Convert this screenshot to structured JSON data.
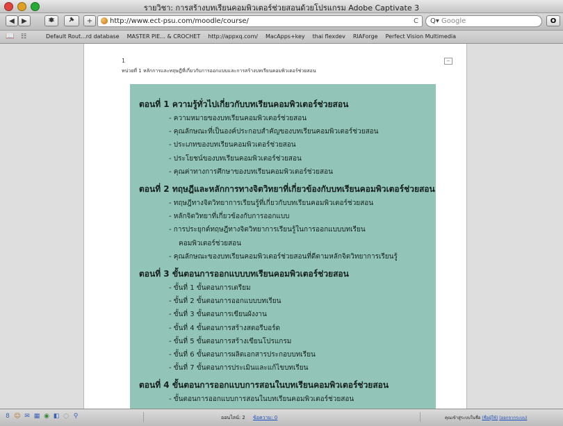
{
  "window": {
    "title": "รายวิชา: การสร้างบทเรียนคอมพิวเตอร์ช่วยสอนด้วยโปรแกรม Adobe Captivate 3"
  },
  "toolbar": {
    "back": "◀",
    "forward": "▶",
    "add": "+",
    "url": "http://www.ect-psu.com/moodle/course/",
    "reload": "C",
    "search_placeholder": "Google",
    "o_button": "O"
  },
  "bookmarks": [
    "Default Rout...rd database",
    "MASTER PIE... & CROCHET",
    "http://appxq.com/",
    "MacApps+key",
    "thai flexdev",
    "RIAForge",
    "Perfect Vision Multimedia"
  ],
  "course": {
    "section_number": "1",
    "section_heading": "หน่วยที่ 1 หลักการและทฤษฎีที่เกี่ยวกับการออกแบบและการสร้างบทเรียนคอมพิวเตอร์ช่วยสอน",
    "collapse_icon": "−"
  },
  "slide": [
    {
      "type": "title",
      "text": "ตอนที่ 1 ความรู้ทั่วไปเกี่ยวกับบทเรียนคอมพิวเตอร์ช่วยสอน"
    },
    {
      "type": "item",
      "text": "- ความหมายของบทเรียนคอมพิวเตอร์ช่วยสอน"
    },
    {
      "type": "item",
      "text": "- คุณลักษณะที่เป็นองค์ประกอบสำคัญของบทเรียนคอมพิวเตอร์ช่วยสอน"
    },
    {
      "type": "item",
      "text": "- ประเภทของบทเรียนคอมพิวเตอร์ช่วยสอน"
    },
    {
      "type": "item",
      "text": "- ประโยชน์ของบทเรียนคอมพิวเตอร์ช่วยสอน"
    },
    {
      "type": "item",
      "text": "- คุณค่าทางการศึกษาของบทเรียนคอมพิวเตอร์ช่วยสอน"
    },
    {
      "type": "title",
      "text": "ตอนที่ 2 ทฤษฎีและหลักการทางจิตวิทยาที่เกี่ยวข้องกับบทเรียนคอมพิวเตอร์ช่วยสอน"
    },
    {
      "type": "item",
      "text": "- ทฤษฎีทางจิตวิทยาการเรียนรู้ที่เกี่ยวกับบทเรียนคอมพิวเตอร์ช่วยสอน"
    },
    {
      "type": "item",
      "text": "- หลักจิตวิทยาที่เกี่ยวข้องกับการออกแบบ"
    },
    {
      "type": "item",
      "text": "- การประยุกต์ทฤษฎีทางจิตวิทยาการเรียนรู้ในการออกแบบบทเรียน"
    },
    {
      "type": "cont",
      "text": "คอมพิวเตอร์ช่วยสอน"
    },
    {
      "type": "item",
      "text": "- คุณลักษณะของบทเรียนคอมพิวเตอร์ช่วยสอนที่ดีตามหลักจิตวิทยาการเรียนรู้"
    },
    {
      "type": "title",
      "text": "ตอนที่ 3 ขั้นตอนการออกแบบบทเรียนคอมพิวเตอร์ช่วยสอน"
    },
    {
      "type": "item",
      "text": "- ขั้นที่ 1 ขั้นตอนการเตรียม"
    },
    {
      "type": "item",
      "text": "- ขั้นที่ 2 ขั้นตอนการออกแบบบทเรียน"
    },
    {
      "type": "item",
      "text": "- ขั้นที่ 3 ขั้นตอนการเขียนผังงาน"
    },
    {
      "type": "item",
      "text": "- ขั้นที่ 4 ขั้นตอนการสร้างสตอรีบอร์ด"
    },
    {
      "type": "item",
      "text": "- ขั้นที่ 5 ขั้นตอนการสร้างเขียนโปรแกรม"
    },
    {
      "type": "item",
      "text": "- ขั้นที่ 6 ขั้นตอนการผลิตเอกสารประกอบบทเรียน"
    },
    {
      "type": "item",
      "text": "- ขั้นที่ 7 ขั้นตอนการประเมินและแก้ไขบทเรียน"
    },
    {
      "type": "title",
      "text": "ตอนที่ 4 ขั้นตอนการออกแบบการสอนในบทเรียนคอมพิวเตอร์ช่วยสอน"
    },
    {
      "type": "item",
      "text": "- ขั้นตอนการออกแบบการสอนในบทเรียนคอมพิวเตอร์ช่วยสอน"
    }
  ],
  "status": {
    "online_label": "ออนไลน์: 2",
    "messages_label": "ข้อความ: 0",
    "login_text": "คุณเข้าสู่ระบบในชื่อ",
    "user_link": "(ชื่อผู้ใช้)",
    "logout_link": "(ออกจากระบบ)"
  }
}
